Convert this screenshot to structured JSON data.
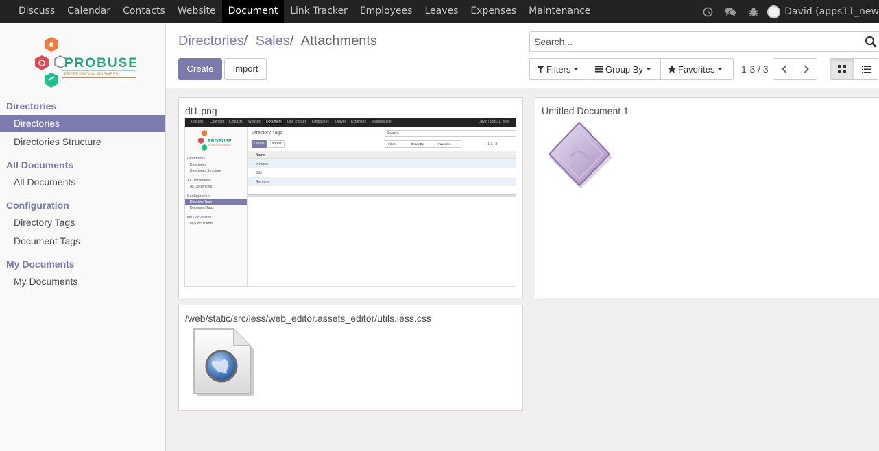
{
  "navbar": {
    "menu": [
      "Discuss",
      "Calendar",
      "Contacts",
      "Website",
      "Document",
      "Link Tracker",
      "Employees",
      "Leaves",
      "Expenses",
      "Maintenance"
    ],
    "active_index": 4,
    "user_name": "David (apps11_new"
  },
  "logo": {
    "brand": "PROBUSE",
    "tagline": "PROFESSIONAL BUSINESS"
  },
  "sidebar": {
    "sections": [
      {
        "title": "Directories",
        "items": [
          {
            "label": "Directories",
            "active": true
          },
          {
            "label": "Directories Structure",
            "active": false
          }
        ]
      },
      {
        "title": "All Documents",
        "items": [
          {
            "label": "All Documents",
            "active": false
          }
        ]
      },
      {
        "title": "Configuration",
        "items": [
          {
            "label": "Directory Tags",
            "active": false
          },
          {
            "label": "Document Tags",
            "active": false
          }
        ]
      },
      {
        "title": "My Documents",
        "items": [
          {
            "label": "My Documents",
            "active": false
          }
        ]
      }
    ]
  },
  "breadcrumb": {
    "items": [
      "Directories",
      "Sales"
    ],
    "current": "Attachments"
  },
  "buttons": {
    "create": "Create",
    "import": "Import"
  },
  "search": {
    "placeholder": "Search..."
  },
  "filters": {
    "filters": "Filters",
    "group_by": "Group By",
    "favorites": "Favorites"
  },
  "pager": {
    "value": "1-3 / 3"
  },
  "cards": [
    {
      "title": "dt1.png",
      "kind": "image-preview"
    },
    {
      "title": "Untitled Document 1",
      "kind": "document-icon"
    },
    {
      "title": "/web/static/src/less/web_editor.assets_editor/utils.less.css",
      "kind": "web-file-icon"
    }
  ],
  "thumbnail": {
    "nav": [
      "Discuss",
      "Calendar",
      "Contacts",
      "Website",
      "Document",
      "Link Tracker",
      "Employees",
      "Leaves",
      "Expenses",
      "Maintenance"
    ],
    "user": "David (apps11_new",
    "brand": "PROBUSE",
    "tagline": "PROFESSIONAL BUSINESS",
    "title": "Directory Tags",
    "create": "Create",
    "import": "Import",
    "search": "Search...",
    "filters": "Filters",
    "group_by": "Group By",
    "favorites": "Favorites",
    "pager": "1-3 / 3",
    "column": "Name",
    "rows": [
      "Invoices",
      "Bills",
      "Receipts"
    ],
    "sidebar": [
      {
        "section": "Directories",
        "items": [
          "Directories",
          "Directories Structure"
        ]
      },
      {
        "section": "All Documents",
        "items": [
          "All Documents"
        ]
      },
      {
        "section": "Configuration",
        "items": [
          "Directory Tags",
          "Document Tags"
        ]
      },
      {
        "section": "My Documents",
        "items": [
          "My Documents"
        ]
      }
    ],
    "active_item": "Directory Tags"
  },
  "colors": {
    "brand": "#7c7bad",
    "navbar": "#232323"
  }
}
